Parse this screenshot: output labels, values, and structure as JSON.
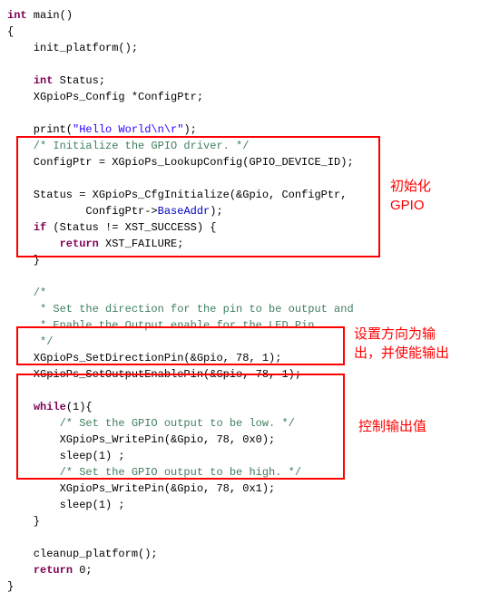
{
  "code": {
    "l1_a": "int",
    "l1_b": " main()",
    "l2": "{",
    "l3": "    init_platform();",
    "l4": "",
    "l5_a": "    ",
    "l5_b": "int",
    "l5_c": " Status;",
    "l6": "    XGpioPs_Config *ConfigPtr;",
    "l7": "",
    "l8_a": "    print(",
    "l8_b": "\"Hello World\\n\\r\"",
    "l8_c": ");",
    "l9": "    /* Initialize the GPIO driver. */",
    "l10": "    ConfigPtr = XGpioPs_LookupConfig(GPIO_DEVICE_ID);",
    "l11": "",
    "l12": "    Status = XGpioPs_CfgInitialize(&Gpio, ConfigPtr,",
    "l13_a": "            ConfigPtr->",
    "l13_b": "BaseAddr",
    "l13_c": ");",
    "l14_a": "    ",
    "l14_b": "if",
    "l14_c": " (Status != XST_SUCCESS) {",
    "l15_a": "        ",
    "l15_b": "return",
    "l15_c": " XST_FAILURE;",
    "l16": "    }",
    "l17": "",
    "l18": "    /*",
    "l19": "     * Set the direction for the pin to be output and",
    "l20": "     * Enable the Output enable for the LED Pin.",
    "l21": "     */",
    "l22": "    XGpioPs_SetDirectionPin(&Gpio, 78, 1);",
    "l23": "    XGpioPs_SetOutputEnablePin(&Gpio, 78, 1);",
    "l24": "",
    "l25_a": "    ",
    "l25_b": "while",
    "l25_c": "(1){",
    "l26": "        /* Set the GPIO output to be low. */",
    "l27": "        XGpioPs_WritePin(&Gpio, 78, 0x0);",
    "l28": "        sleep(1) ;",
    "l29": "        /* Set the GPIO output to be high. */",
    "l30": "        XGpioPs_WritePin(&Gpio, 78, 0x1);",
    "l31": "        sleep(1) ;",
    "l32": "    }",
    "l33": "",
    "l34": "    cleanup_platform();",
    "l35_a": "    ",
    "l35_b": "return",
    "l35_c": " 0;",
    "l36": "}"
  },
  "ann": {
    "a1_l1": "初始化",
    "a1_l2": "GPIO",
    "a2_l1": "设置方向为输",
    "a2_l2": "出，并使能输出",
    "a3": "控制输出值"
  }
}
